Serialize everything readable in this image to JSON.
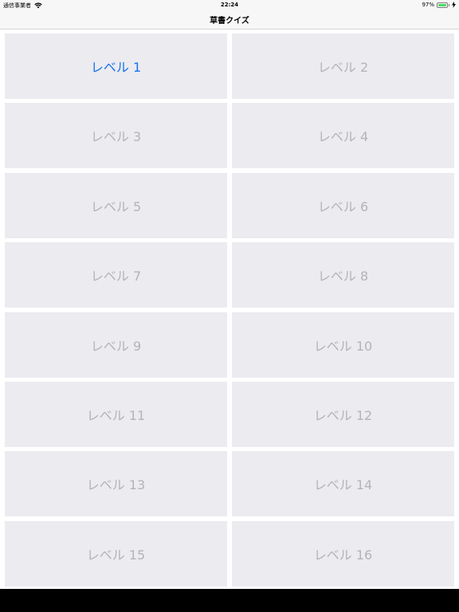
{
  "status_bar": {
    "carrier": "通信事業者",
    "time": "22:24",
    "battery_percent": "97%",
    "battery_level": 0.97,
    "wifi_icon": "wifi-icon",
    "battery_icon": "battery-icon",
    "charge_icon": "lightning-icon"
  },
  "nav": {
    "title": "草書クイズ"
  },
  "colors": {
    "active": "#1a73e8",
    "inactive": "#b4b4b8",
    "tile": "#ebebf0"
  },
  "levels": [
    {
      "label": "レベル 1",
      "active": true
    },
    {
      "label": "レベル 2",
      "active": false
    },
    {
      "label": "レベル 3",
      "active": false
    },
    {
      "label": "レベル 4",
      "active": false
    },
    {
      "label": "レベル 5",
      "active": false
    },
    {
      "label": "レベル 6",
      "active": false
    },
    {
      "label": "レベル 7",
      "active": false
    },
    {
      "label": "レベル 8",
      "active": false
    },
    {
      "label": "レベル 9",
      "active": false
    },
    {
      "label": "レベル 10",
      "active": false
    },
    {
      "label": "レベル 11",
      "active": false
    },
    {
      "label": "レベル 12",
      "active": false
    },
    {
      "label": "レベル 13",
      "active": false
    },
    {
      "label": "レベル 14",
      "active": false
    },
    {
      "label": "レベル 15",
      "active": false
    },
    {
      "label": "レベル 16",
      "active": false
    }
  ]
}
